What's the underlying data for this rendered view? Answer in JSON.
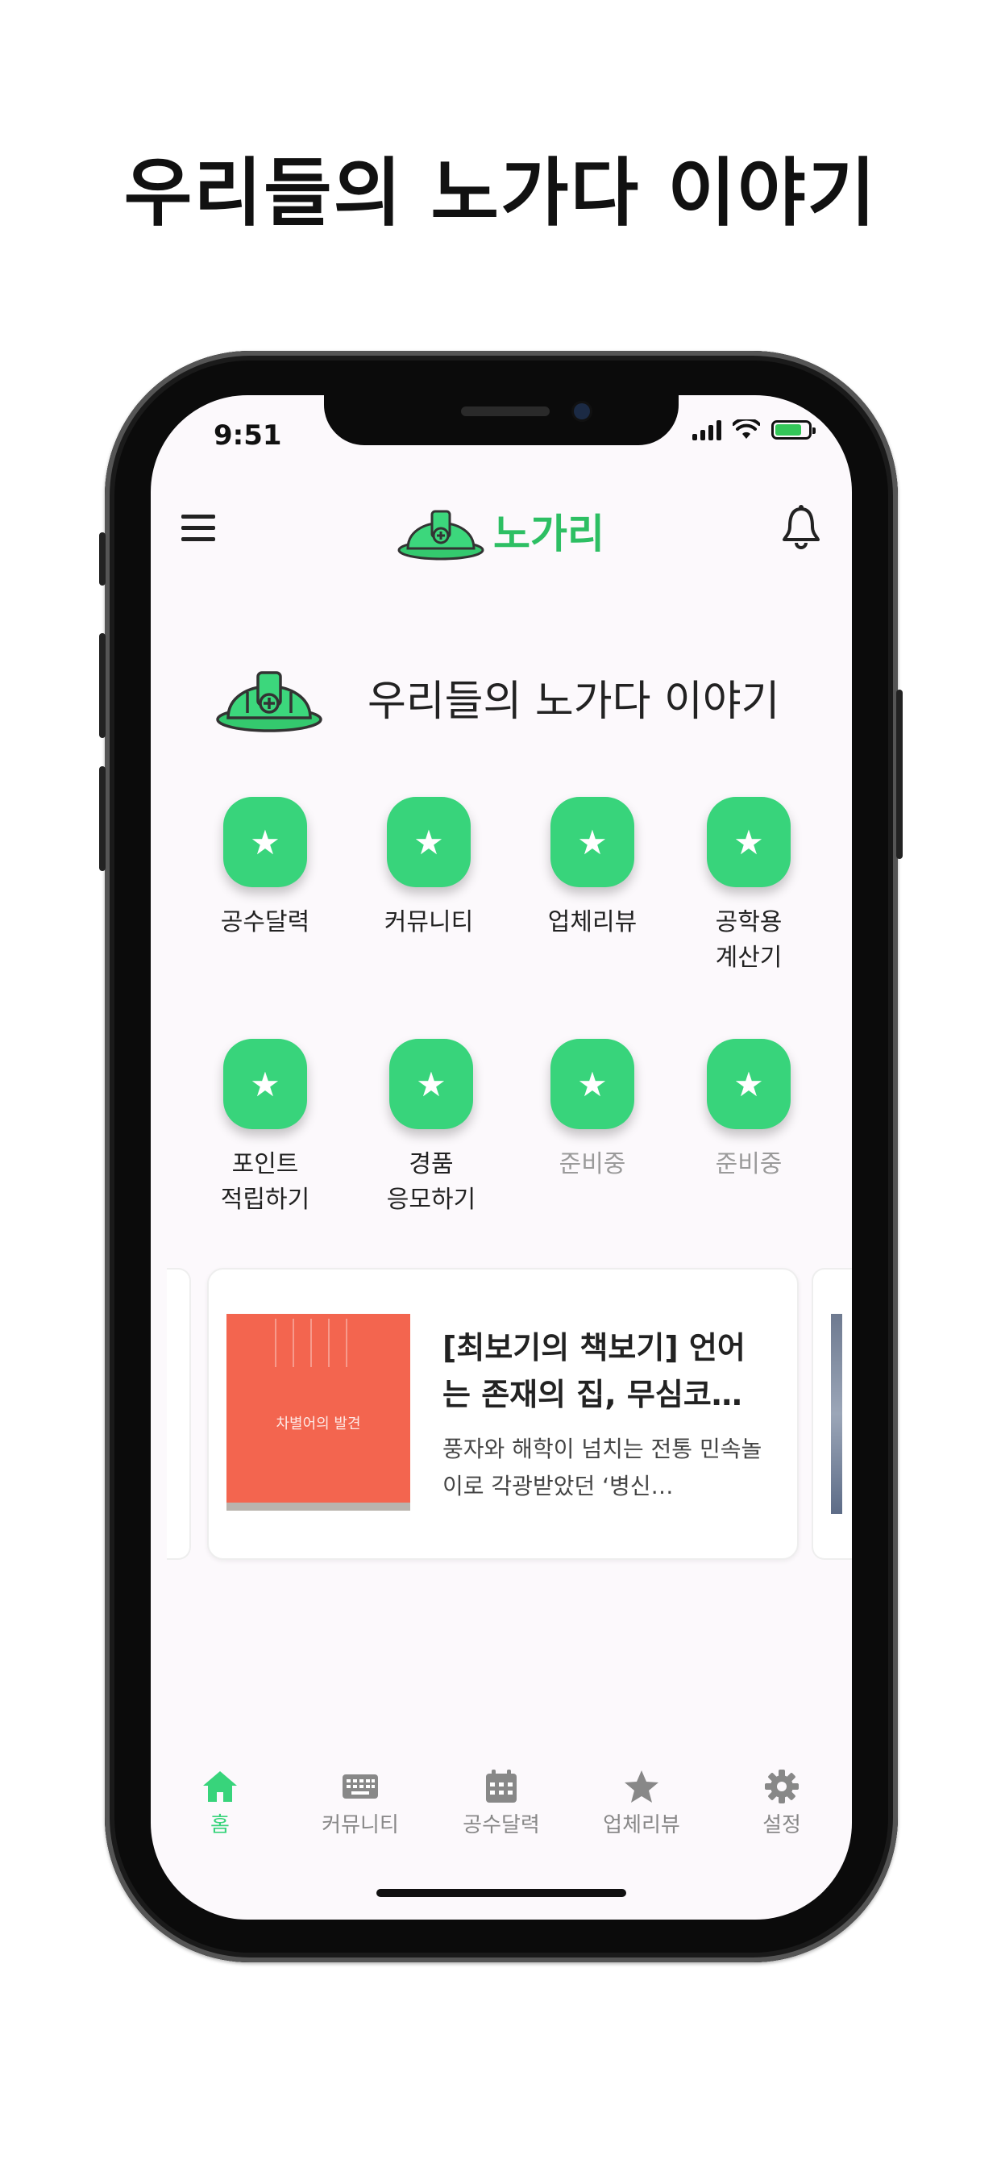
{
  "promo": {
    "title": "우리들의 노가다 이야기"
  },
  "status_bar": {
    "time": "9:51"
  },
  "header": {
    "logo_text": "노가리"
  },
  "hero": {
    "title": "우리들의 노가다 이야기"
  },
  "menu_grid": [
    {
      "label": "공수달력",
      "enabled": true
    },
    {
      "label": "커뮤니티",
      "enabled": true
    },
    {
      "label": "업체리뷰",
      "enabled": true
    },
    {
      "label": "공학용\n계산기",
      "enabled": true
    },
    {
      "label": "포인트\n적립하기",
      "enabled": true
    },
    {
      "label": "경품\n응모하기",
      "enabled": true
    },
    {
      "label": "준비중",
      "enabled": false
    },
    {
      "label": "준비중",
      "enabled": false
    }
  ],
  "article_card": {
    "title": "[최보기의 책보기] 언어는 존재의 집, 무심코…",
    "description": "풍자와 해학이 넘치는 전통 민속놀이로 각광받았던 ‘병신…",
    "thumb_text": "차별어의 발견"
  },
  "tab_bar": [
    {
      "label": "홈",
      "icon": "home-icon",
      "active": true
    },
    {
      "label": "커뮤니티",
      "icon": "keyboard-icon",
      "active": false
    },
    {
      "label": "공수달력",
      "icon": "calendar-icon",
      "active": false
    },
    {
      "label": "업체리뷰",
      "icon": "star-icon",
      "active": false
    },
    {
      "label": "설정",
      "icon": "gear-icon",
      "active": false
    }
  ],
  "colors": {
    "brand_green": "#38d47b",
    "logo_green": "#2dbf63",
    "inactive_gray": "#888888"
  }
}
